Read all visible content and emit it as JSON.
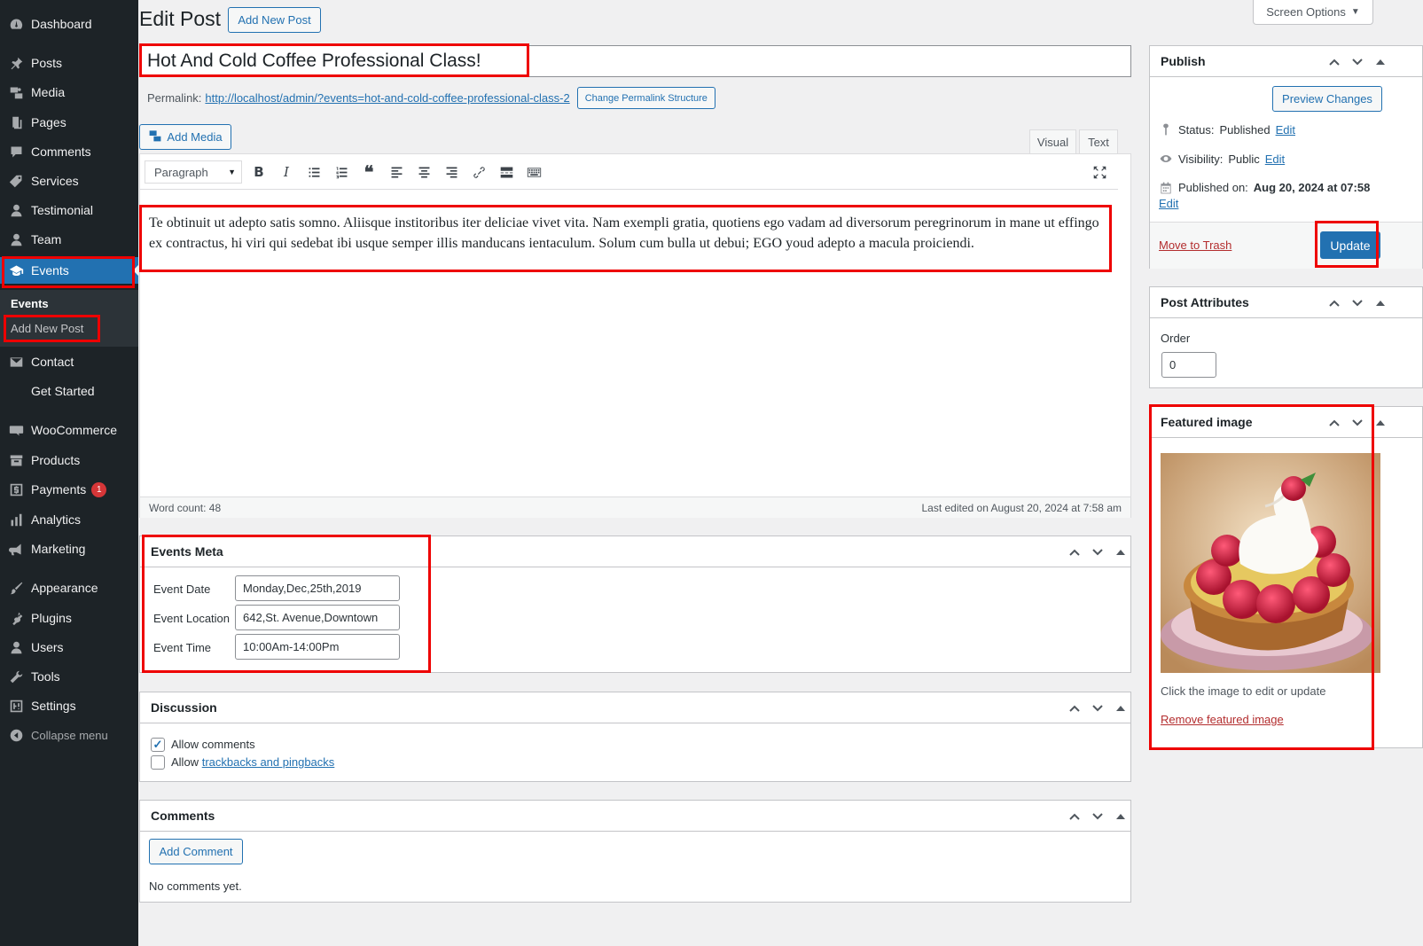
{
  "sidebar": {
    "items": [
      {
        "label": "Dashboard"
      },
      {
        "label": "Posts"
      },
      {
        "label": "Media"
      },
      {
        "label": "Pages"
      },
      {
        "label": "Comments"
      },
      {
        "label": "Services"
      },
      {
        "label": "Testimonial"
      },
      {
        "label": "Team"
      },
      {
        "label": "Events"
      },
      {
        "label": "Contact"
      },
      {
        "label": "Get Started"
      },
      {
        "label": "WooCommerce"
      },
      {
        "label": "Products"
      },
      {
        "label": "Payments",
        "badge": "1"
      },
      {
        "label": "Analytics"
      },
      {
        "label": "Marketing"
      },
      {
        "label": "Appearance"
      },
      {
        "label": "Plugins"
      },
      {
        "label": "Users"
      },
      {
        "label": "Tools"
      },
      {
        "label": "Settings"
      },
      {
        "label": "Collapse menu"
      }
    ],
    "submenu": {
      "current": "Events",
      "add_new": "Add New Post"
    }
  },
  "header": {
    "title": "Edit Post",
    "add_new": "Add New Post",
    "screen_options": "Screen Options"
  },
  "post": {
    "title": "Hot And Cold Coffee Professional Class!",
    "permalink_label": "Permalink:",
    "permalink_url": "http://localhost/admin/?events=hot-and-cold-coffee-professional-class-2",
    "change_permalink": "Change Permalink Structure"
  },
  "editor": {
    "add_media": "Add Media",
    "tab_visual": "Visual",
    "tab_text": "Text",
    "format": "Paragraph",
    "content": "Te obtinuit ut adepto satis somno. Aliisque institoribus iter deliciae vivet vita. Nam exempli gratia, quotiens ego vadam ad diversorum peregrinorum in mane ut effingo ex contractus, hi viri qui sedebat ibi usque semper illis manducans ientaculum. Solum cum bulla ut debui; EGO youd adepto a macula proiciendi.",
    "word_count": "Word count: 48",
    "last_edited": "Last edited on August 20, 2024 at 7:58 am"
  },
  "events_meta": {
    "title": "Events Meta",
    "date_label": "Event Date",
    "date_value": "Monday,Dec,25th,2019",
    "location_label": "Event Location",
    "location_value": "642,St. Avenue,Downtown",
    "time_label": "Event Time",
    "time_value": "10:00Am-14:00Pm"
  },
  "discussion": {
    "title": "Discussion",
    "allow_comments": "Allow comments",
    "allow_trackbacks_prefix": "Allow",
    "allow_trackbacks_link": "trackbacks and pingbacks"
  },
  "comments": {
    "title": "Comments",
    "add_comment": "Add Comment",
    "empty": "No comments yet."
  },
  "publish": {
    "title": "Publish",
    "preview": "Preview Changes",
    "status_label": "Status:",
    "status_value": "Published",
    "visibility_label": "Visibility:",
    "visibility_value": "Public",
    "published_label": "Published on:",
    "published_value": "Aug 20, 2024 at 07:58",
    "edit": "Edit",
    "trash": "Move to Trash",
    "update": "Update"
  },
  "attributes": {
    "title": "Post Attributes",
    "order_label": "Order",
    "order_value": "0"
  },
  "featured": {
    "title": "Featured image",
    "hint": "Click the image to edit or update",
    "remove": "Remove featured image"
  },
  "colors": {
    "sidebar_bg": "#1d2327",
    "accent": "#2271b1",
    "highlight_box": "#e00000",
    "trash": "#b32d2e"
  }
}
